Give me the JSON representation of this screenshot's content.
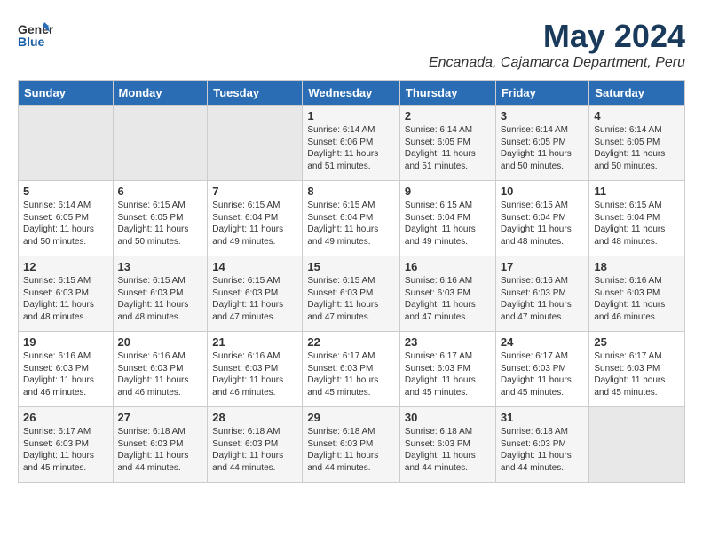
{
  "header": {
    "logo_general": "General",
    "logo_blue": "Blue",
    "title": "May 2024",
    "subtitle": "Encanada, Cajamarca Department, Peru"
  },
  "columns": [
    "Sunday",
    "Monday",
    "Tuesday",
    "Wednesday",
    "Thursday",
    "Friday",
    "Saturday"
  ],
  "weeks": [
    [
      {
        "day": "",
        "data": ""
      },
      {
        "day": "",
        "data": ""
      },
      {
        "day": "",
        "data": ""
      },
      {
        "day": "1",
        "data": "Sunrise: 6:14 AM\nSunset: 6:06 PM\nDaylight: 11 hours\nand 51 minutes."
      },
      {
        "day": "2",
        "data": "Sunrise: 6:14 AM\nSunset: 6:05 PM\nDaylight: 11 hours\nand 51 minutes."
      },
      {
        "day": "3",
        "data": "Sunrise: 6:14 AM\nSunset: 6:05 PM\nDaylight: 11 hours\nand 50 minutes."
      },
      {
        "day": "4",
        "data": "Sunrise: 6:14 AM\nSunset: 6:05 PM\nDaylight: 11 hours\nand 50 minutes."
      }
    ],
    [
      {
        "day": "5",
        "data": "Sunrise: 6:14 AM\nSunset: 6:05 PM\nDaylight: 11 hours\nand 50 minutes."
      },
      {
        "day": "6",
        "data": "Sunrise: 6:15 AM\nSunset: 6:05 PM\nDaylight: 11 hours\nand 50 minutes."
      },
      {
        "day": "7",
        "data": "Sunrise: 6:15 AM\nSunset: 6:04 PM\nDaylight: 11 hours\nand 49 minutes."
      },
      {
        "day": "8",
        "data": "Sunrise: 6:15 AM\nSunset: 6:04 PM\nDaylight: 11 hours\nand 49 minutes."
      },
      {
        "day": "9",
        "data": "Sunrise: 6:15 AM\nSunset: 6:04 PM\nDaylight: 11 hours\nand 49 minutes."
      },
      {
        "day": "10",
        "data": "Sunrise: 6:15 AM\nSunset: 6:04 PM\nDaylight: 11 hours\nand 48 minutes."
      },
      {
        "day": "11",
        "data": "Sunrise: 6:15 AM\nSunset: 6:04 PM\nDaylight: 11 hours\nand 48 minutes."
      }
    ],
    [
      {
        "day": "12",
        "data": "Sunrise: 6:15 AM\nSunset: 6:03 PM\nDaylight: 11 hours\nand 48 minutes."
      },
      {
        "day": "13",
        "data": "Sunrise: 6:15 AM\nSunset: 6:03 PM\nDaylight: 11 hours\nand 48 minutes."
      },
      {
        "day": "14",
        "data": "Sunrise: 6:15 AM\nSunset: 6:03 PM\nDaylight: 11 hours\nand 47 minutes."
      },
      {
        "day": "15",
        "data": "Sunrise: 6:15 AM\nSunset: 6:03 PM\nDaylight: 11 hours\nand 47 minutes."
      },
      {
        "day": "16",
        "data": "Sunrise: 6:16 AM\nSunset: 6:03 PM\nDaylight: 11 hours\nand 47 minutes."
      },
      {
        "day": "17",
        "data": "Sunrise: 6:16 AM\nSunset: 6:03 PM\nDaylight: 11 hours\nand 47 minutes."
      },
      {
        "day": "18",
        "data": "Sunrise: 6:16 AM\nSunset: 6:03 PM\nDaylight: 11 hours\nand 46 minutes."
      }
    ],
    [
      {
        "day": "19",
        "data": "Sunrise: 6:16 AM\nSunset: 6:03 PM\nDaylight: 11 hours\nand 46 minutes."
      },
      {
        "day": "20",
        "data": "Sunrise: 6:16 AM\nSunset: 6:03 PM\nDaylight: 11 hours\nand 46 minutes."
      },
      {
        "day": "21",
        "data": "Sunrise: 6:16 AM\nSunset: 6:03 PM\nDaylight: 11 hours\nand 46 minutes."
      },
      {
        "day": "22",
        "data": "Sunrise: 6:17 AM\nSunset: 6:03 PM\nDaylight: 11 hours\nand 45 minutes."
      },
      {
        "day": "23",
        "data": "Sunrise: 6:17 AM\nSunset: 6:03 PM\nDaylight: 11 hours\nand 45 minutes."
      },
      {
        "day": "24",
        "data": "Sunrise: 6:17 AM\nSunset: 6:03 PM\nDaylight: 11 hours\nand 45 minutes."
      },
      {
        "day": "25",
        "data": "Sunrise: 6:17 AM\nSunset: 6:03 PM\nDaylight: 11 hours\nand 45 minutes."
      }
    ],
    [
      {
        "day": "26",
        "data": "Sunrise: 6:17 AM\nSunset: 6:03 PM\nDaylight: 11 hours\nand 45 minutes."
      },
      {
        "day": "27",
        "data": "Sunrise: 6:18 AM\nSunset: 6:03 PM\nDaylight: 11 hours\nand 44 minutes."
      },
      {
        "day": "28",
        "data": "Sunrise: 6:18 AM\nSunset: 6:03 PM\nDaylight: 11 hours\nand 44 minutes."
      },
      {
        "day": "29",
        "data": "Sunrise: 6:18 AM\nSunset: 6:03 PM\nDaylight: 11 hours\nand 44 minutes."
      },
      {
        "day": "30",
        "data": "Sunrise: 6:18 AM\nSunset: 6:03 PM\nDaylight: 11 hours\nand 44 minutes."
      },
      {
        "day": "31",
        "data": "Sunrise: 6:18 AM\nSunset: 6:03 PM\nDaylight: 11 hours\nand 44 minutes."
      },
      {
        "day": "",
        "data": ""
      }
    ]
  ]
}
